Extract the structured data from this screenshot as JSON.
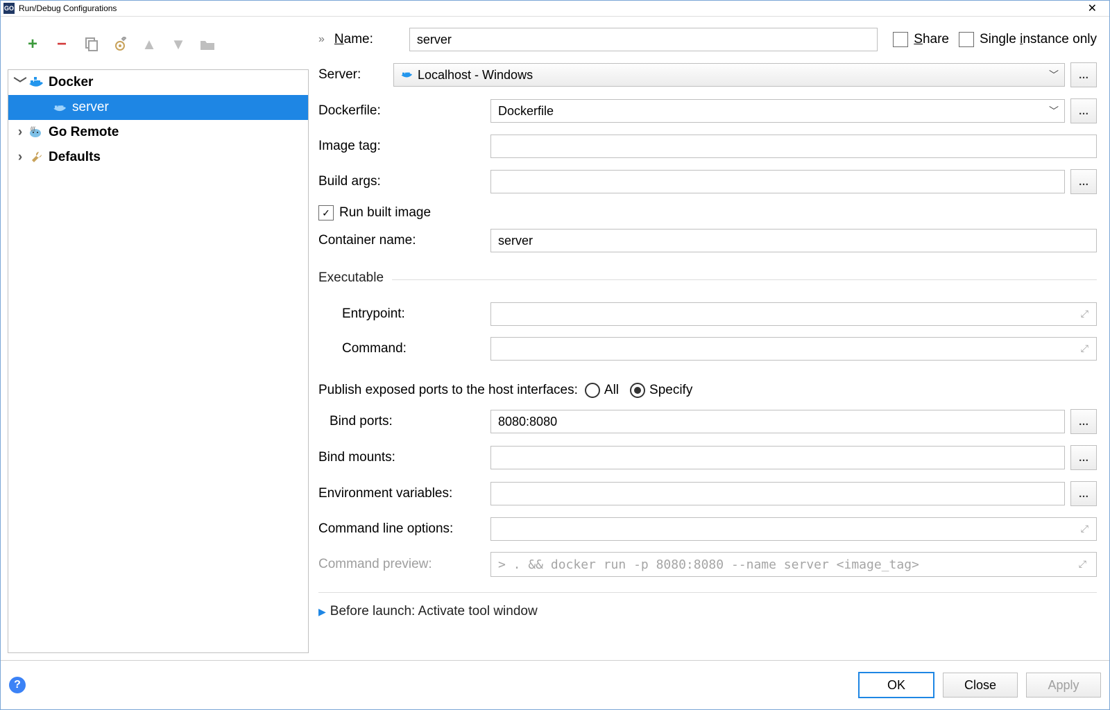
{
  "window": {
    "title": "Run/Debug Configurations"
  },
  "tree": {
    "docker": "Docker",
    "server": "server",
    "go_remote": "Go Remote",
    "defaults": "Defaults"
  },
  "topbar": {
    "name_label": "ame:",
    "name_value": "server",
    "share": "hare",
    "single_instance": "Single ",
    "single_instance_rest": "nstance only"
  },
  "form": {
    "server_label": "Server:",
    "server_value": "Localhost - Windows",
    "dockerfile_label": "Dockerfile:",
    "dockerfile_value": "Dockerfile",
    "image_tag_label": "Image tag:",
    "image_tag_value": "",
    "build_args_label": "Build args:",
    "build_args_value": "",
    "run_built_image": "Run built image",
    "container_name_label": "Container name:",
    "container_name_value": "server",
    "executable_section": "Executable",
    "entrypoint_label": "Entrypoint:",
    "entrypoint_value": "",
    "command_label": "Command:",
    "command_value": "",
    "publish_ports_label": "Publish exposed ports to the host interfaces:",
    "radio_all": "All",
    "radio_specify": "Specify",
    "bind_ports_label": "Bind ports:",
    "bind_ports_value": "8080:8080",
    "bind_mounts_label": "Bind mounts:",
    "bind_mounts_value": "",
    "env_vars_label": "Environment variables:",
    "env_vars_value": "",
    "cli_options_label": "Command line options:",
    "cli_options_value": "",
    "cmd_preview_label": "Command preview:",
    "cmd_preview_value": "> . && docker run -p 8080:8080 --name server <image_tag>",
    "before_launch": "Before launch: Activate tool window"
  },
  "footer": {
    "ok": "OK",
    "close": "Close",
    "apply": "Apply"
  }
}
